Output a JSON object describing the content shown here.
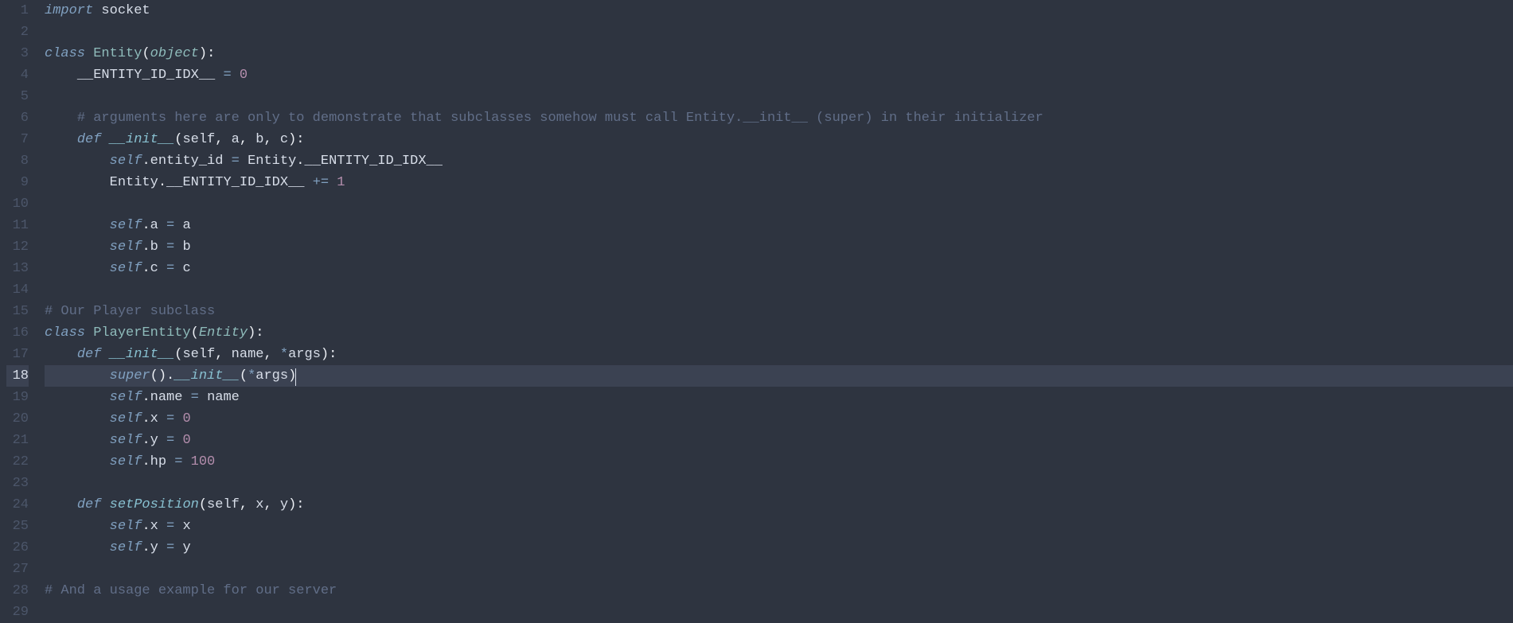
{
  "editor": {
    "active_line": 18,
    "lines": [
      {
        "n": 1,
        "tokens": [
          {
            "t": "import",
            "c": "kw"
          },
          {
            "t": " ",
            "c": ""
          },
          {
            "t": "socket",
            "c": "prop"
          }
        ]
      },
      {
        "n": 2,
        "tokens": []
      },
      {
        "n": 3,
        "tokens": [
          {
            "t": "class",
            "c": "kw"
          },
          {
            "t": " ",
            "c": ""
          },
          {
            "t": "Entity",
            "c": "cls"
          },
          {
            "t": "(",
            "c": "punct"
          },
          {
            "t": "object",
            "c": "typ"
          },
          {
            "t": ")",
            "c": "punct"
          },
          {
            "t": ":",
            "c": "punct"
          }
        ]
      },
      {
        "n": 4,
        "tokens": [
          {
            "t": "    ",
            "c": ""
          },
          {
            "t": "__ENTITY_ID_IDX__",
            "c": "prop"
          },
          {
            "t": " ",
            "c": ""
          },
          {
            "t": "=",
            "c": "op"
          },
          {
            "t": " ",
            "c": ""
          },
          {
            "t": "0",
            "c": "num"
          }
        ]
      },
      {
        "n": 5,
        "tokens": []
      },
      {
        "n": 6,
        "tokens": [
          {
            "t": "    ",
            "c": ""
          },
          {
            "t": "# arguments here are only to demonstrate that subclasses somehow must call Entity.__init__ (super) in their initializer",
            "c": "cmt"
          }
        ]
      },
      {
        "n": 7,
        "tokens": [
          {
            "t": "    ",
            "c": ""
          },
          {
            "t": "def",
            "c": "kw"
          },
          {
            "t": " ",
            "c": ""
          },
          {
            "t": "__init__",
            "c": "fn"
          },
          {
            "t": "(",
            "c": "punct"
          },
          {
            "t": "self",
            "c": "param"
          },
          {
            "t": ",",
            "c": "punct"
          },
          {
            "t": " ",
            "c": ""
          },
          {
            "t": "a",
            "c": "param"
          },
          {
            "t": ",",
            "c": "punct"
          },
          {
            "t": " ",
            "c": ""
          },
          {
            "t": "b",
            "c": "param"
          },
          {
            "t": ",",
            "c": "punct"
          },
          {
            "t": " ",
            "c": ""
          },
          {
            "t": "c",
            "c": "param"
          },
          {
            "t": ")",
            "c": "punct"
          },
          {
            "t": ":",
            "c": "punct"
          }
        ]
      },
      {
        "n": 8,
        "tokens": [
          {
            "t": "        ",
            "c": ""
          },
          {
            "t": "self",
            "c": "self"
          },
          {
            "t": ".",
            "c": "punct"
          },
          {
            "t": "entity_id",
            "c": "prop"
          },
          {
            "t": " ",
            "c": ""
          },
          {
            "t": "=",
            "c": "op"
          },
          {
            "t": " ",
            "c": ""
          },
          {
            "t": "Entity",
            "c": "prop"
          },
          {
            "t": ".",
            "c": "punct"
          },
          {
            "t": "__ENTITY_ID_IDX__",
            "c": "prop"
          }
        ]
      },
      {
        "n": 9,
        "tokens": [
          {
            "t": "        ",
            "c": ""
          },
          {
            "t": "Entity",
            "c": "prop"
          },
          {
            "t": ".",
            "c": "punct"
          },
          {
            "t": "__ENTITY_ID_IDX__",
            "c": "prop"
          },
          {
            "t": " ",
            "c": ""
          },
          {
            "t": "+=",
            "c": "op"
          },
          {
            "t": " ",
            "c": ""
          },
          {
            "t": "1",
            "c": "num"
          }
        ]
      },
      {
        "n": 10,
        "tokens": []
      },
      {
        "n": 11,
        "tokens": [
          {
            "t": "        ",
            "c": ""
          },
          {
            "t": "self",
            "c": "self"
          },
          {
            "t": ".",
            "c": "punct"
          },
          {
            "t": "a",
            "c": "prop"
          },
          {
            "t": " ",
            "c": ""
          },
          {
            "t": "=",
            "c": "op"
          },
          {
            "t": " ",
            "c": ""
          },
          {
            "t": "a",
            "c": "prop"
          }
        ]
      },
      {
        "n": 12,
        "tokens": [
          {
            "t": "        ",
            "c": ""
          },
          {
            "t": "self",
            "c": "self"
          },
          {
            "t": ".",
            "c": "punct"
          },
          {
            "t": "b",
            "c": "prop"
          },
          {
            "t": " ",
            "c": ""
          },
          {
            "t": "=",
            "c": "op"
          },
          {
            "t": " ",
            "c": ""
          },
          {
            "t": "b",
            "c": "prop"
          }
        ]
      },
      {
        "n": 13,
        "tokens": [
          {
            "t": "        ",
            "c": ""
          },
          {
            "t": "self",
            "c": "self"
          },
          {
            "t": ".",
            "c": "punct"
          },
          {
            "t": "c",
            "c": "prop"
          },
          {
            "t": " ",
            "c": ""
          },
          {
            "t": "=",
            "c": "op"
          },
          {
            "t": " ",
            "c": ""
          },
          {
            "t": "c",
            "c": "prop"
          }
        ]
      },
      {
        "n": 14,
        "tokens": []
      },
      {
        "n": 15,
        "tokens": [
          {
            "t": "# Our Player subclass",
            "c": "cmt"
          }
        ]
      },
      {
        "n": 16,
        "tokens": [
          {
            "t": "class",
            "c": "kw"
          },
          {
            "t": " ",
            "c": ""
          },
          {
            "t": "PlayerEntity",
            "c": "cls"
          },
          {
            "t": "(",
            "c": "punct"
          },
          {
            "t": "Entity",
            "c": "typ"
          },
          {
            "t": ")",
            "c": "punct"
          },
          {
            "t": ":",
            "c": "punct"
          }
        ]
      },
      {
        "n": 17,
        "tokens": [
          {
            "t": "    ",
            "c": ""
          },
          {
            "t": "def",
            "c": "kw"
          },
          {
            "t": " ",
            "c": ""
          },
          {
            "t": "__init__",
            "c": "fn"
          },
          {
            "t": "(",
            "c": "punct"
          },
          {
            "t": "self",
            "c": "param"
          },
          {
            "t": ",",
            "c": "punct"
          },
          {
            "t": " ",
            "c": ""
          },
          {
            "t": "name",
            "c": "param"
          },
          {
            "t": ",",
            "c": "punct"
          },
          {
            "t": " ",
            "c": ""
          },
          {
            "t": "*",
            "c": "op"
          },
          {
            "t": "args",
            "c": "param"
          },
          {
            "t": ")",
            "c": "punct"
          },
          {
            "t": ":",
            "c": "punct"
          }
        ]
      },
      {
        "n": 18,
        "tokens": [
          {
            "t": "        ",
            "c": ""
          },
          {
            "t": "super",
            "c": "builtin"
          },
          {
            "t": "()",
            "c": "punct"
          },
          {
            "t": ".",
            "c": "punct"
          },
          {
            "t": "__init__",
            "c": "fn"
          },
          {
            "t": "(",
            "c": "punct"
          },
          {
            "t": "*",
            "c": "op"
          },
          {
            "t": "args",
            "c": "prop"
          },
          {
            "t": ")",
            "c": "punct"
          }
        ],
        "cursor": true
      },
      {
        "n": 19,
        "tokens": [
          {
            "t": "        ",
            "c": ""
          },
          {
            "t": "self",
            "c": "self"
          },
          {
            "t": ".",
            "c": "punct"
          },
          {
            "t": "name",
            "c": "prop"
          },
          {
            "t": " ",
            "c": ""
          },
          {
            "t": "=",
            "c": "op"
          },
          {
            "t": " ",
            "c": ""
          },
          {
            "t": "name",
            "c": "prop"
          }
        ]
      },
      {
        "n": 20,
        "tokens": [
          {
            "t": "        ",
            "c": ""
          },
          {
            "t": "self",
            "c": "self"
          },
          {
            "t": ".",
            "c": "punct"
          },
          {
            "t": "x",
            "c": "prop"
          },
          {
            "t": " ",
            "c": ""
          },
          {
            "t": "=",
            "c": "op"
          },
          {
            "t": " ",
            "c": ""
          },
          {
            "t": "0",
            "c": "num"
          }
        ]
      },
      {
        "n": 21,
        "tokens": [
          {
            "t": "        ",
            "c": ""
          },
          {
            "t": "self",
            "c": "self"
          },
          {
            "t": ".",
            "c": "punct"
          },
          {
            "t": "y",
            "c": "prop"
          },
          {
            "t": " ",
            "c": ""
          },
          {
            "t": "=",
            "c": "op"
          },
          {
            "t": " ",
            "c": ""
          },
          {
            "t": "0",
            "c": "num"
          }
        ]
      },
      {
        "n": 22,
        "tokens": [
          {
            "t": "        ",
            "c": ""
          },
          {
            "t": "self",
            "c": "self"
          },
          {
            "t": ".",
            "c": "punct"
          },
          {
            "t": "hp",
            "c": "prop"
          },
          {
            "t": " ",
            "c": ""
          },
          {
            "t": "=",
            "c": "op"
          },
          {
            "t": " ",
            "c": ""
          },
          {
            "t": "100",
            "c": "num"
          }
        ]
      },
      {
        "n": 23,
        "tokens": []
      },
      {
        "n": 24,
        "tokens": [
          {
            "t": "    ",
            "c": ""
          },
          {
            "t": "def",
            "c": "kw"
          },
          {
            "t": " ",
            "c": ""
          },
          {
            "t": "setPosition",
            "c": "fn"
          },
          {
            "t": "(",
            "c": "punct"
          },
          {
            "t": "self",
            "c": "param"
          },
          {
            "t": ",",
            "c": "punct"
          },
          {
            "t": " ",
            "c": ""
          },
          {
            "t": "x",
            "c": "param"
          },
          {
            "t": ",",
            "c": "punct"
          },
          {
            "t": " ",
            "c": ""
          },
          {
            "t": "y",
            "c": "param"
          },
          {
            "t": ")",
            "c": "punct"
          },
          {
            "t": ":",
            "c": "punct"
          }
        ]
      },
      {
        "n": 25,
        "tokens": [
          {
            "t": "        ",
            "c": ""
          },
          {
            "t": "self",
            "c": "self"
          },
          {
            "t": ".",
            "c": "punct"
          },
          {
            "t": "x",
            "c": "prop"
          },
          {
            "t": " ",
            "c": ""
          },
          {
            "t": "=",
            "c": "op"
          },
          {
            "t": " ",
            "c": ""
          },
          {
            "t": "x",
            "c": "prop"
          }
        ]
      },
      {
        "n": 26,
        "tokens": [
          {
            "t": "        ",
            "c": ""
          },
          {
            "t": "self",
            "c": "self"
          },
          {
            "t": ".",
            "c": "punct"
          },
          {
            "t": "y",
            "c": "prop"
          },
          {
            "t": " ",
            "c": ""
          },
          {
            "t": "=",
            "c": "op"
          },
          {
            "t": " ",
            "c": ""
          },
          {
            "t": "y",
            "c": "prop"
          }
        ]
      },
      {
        "n": 27,
        "tokens": []
      },
      {
        "n": 28,
        "tokens": [
          {
            "t": "# And a usage example for our server",
            "c": "cmt"
          }
        ]
      },
      {
        "n": 29,
        "tokens": []
      }
    ]
  }
}
